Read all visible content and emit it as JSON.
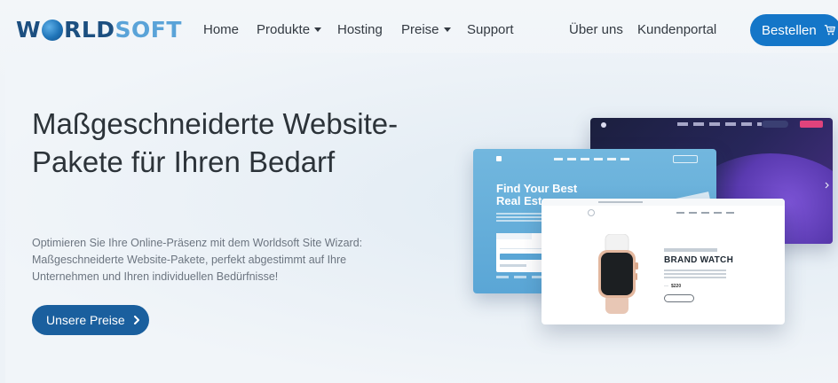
{
  "header": {
    "logo": {
      "w": "W",
      "rld": "RLD",
      "soft": "SOFT"
    },
    "nav": [
      {
        "label": "Home",
        "dropdown": false
      },
      {
        "label": "Produkte",
        "dropdown": true
      },
      {
        "label": "Hosting",
        "dropdown": false
      },
      {
        "label": "Preise",
        "dropdown": true
      },
      {
        "label": "Support",
        "dropdown": false
      },
      {
        "label": "Über uns",
        "dropdown": false
      },
      {
        "label": "Kundenportal",
        "dropdown": false
      }
    ],
    "order_button": "Bestellen"
  },
  "hero": {
    "title": "Maßgeschneiderte Website-Pakete für Ihren Bedarf",
    "subtitle": "Optimieren Sie Ihre Online-Präsenz mit dem Worldsoft Site Wizard: Maßgeschneiderte Website-Pakete, perfekt abgestimmt auf Ihre Unternehmen und Ihren individuellen Bedürfnisse!",
    "cta": "Unsere Preise"
  },
  "mockups": {
    "real_estate_headline": "Find Your Best Real Esta",
    "watch_title": "BRAND WATCH",
    "watch_price": "$220"
  },
  "colors": {
    "primary_blue": "#1476c8",
    "cta_blue": "#1a5f9e",
    "logo_dark": "#1c4f80",
    "logo_light": "#5aa3d8",
    "text_dark": "#2c3339"
  }
}
